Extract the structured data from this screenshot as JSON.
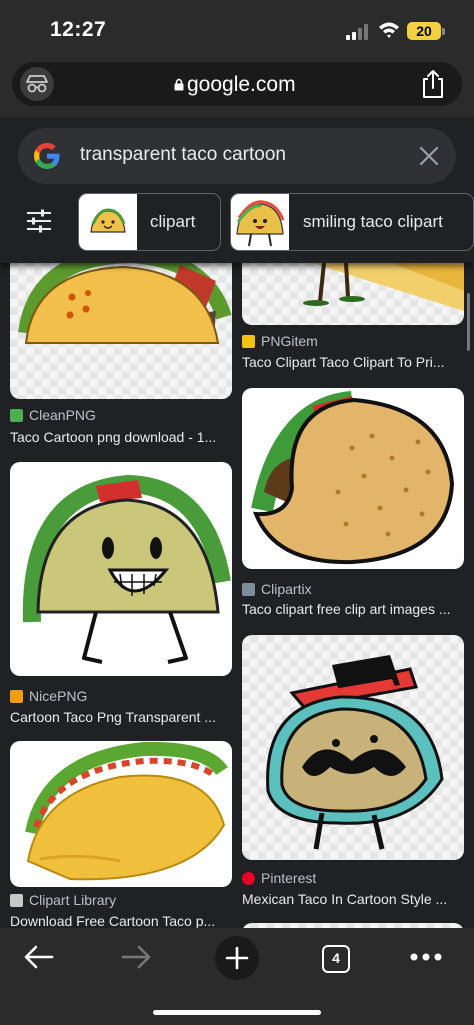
{
  "status_bar": {
    "time": "12:27",
    "battery": "20",
    "battery_color": "#f4d03f"
  },
  "browser": {
    "url": "google.com",
    "icons": [
      "incognito-icon",
      "lock-icon",
      "share-icon"
    ]
  },
  "search": {
    "query": "transparent taco cartoon",
    "icons": [
      "google-logo-icon",
      "clear-icon",
      "filter-icon"
    ]
  },
  "chips": [
    {
      "label": "clipart"
    },
    {
      "label": "smiling taco clipart"
    }
  ],
  "results": {
    "left": [
      {
        "source": "CleanPNG",
        "title": "Taco Cartoon png download - 1...",
        "favicon_color": "#4caf50"
      },
      {
        "source": "NicePNG",
        "title": "Cartoon Taco Png Transparent ...",
        "favicon_color": "#f39c12"
      },
      {
        "source": "Clipart Library",
        "title": "Download Free Cartoon Taco p...",
        "favicon_color": "#c7c7c7"
      }
    ],
    "right": [
      {
        "source": "PNGitem",
        "title": "Taco Clipart Taco Clipart To Pri...",
        "favicon_color": "#f1c40f"
      },
      {
        "source": "Clipartix",
        "title": "Taco clipart free clip art images ...",
        "favicon_color": "#7f8c9a"
      },
      {
        "source": "Pinterest",
        "title": "Mexican Taco In Cartoon Style ...",
        "favicon_color": "#e60023"
      }
    ]
  },
  "bottom_bar": {
    "tab_count": "4",
    "icons": [
      "back-arrow-icon",
      "forward-arrow-icon",
      "plus-icon",
      "more-icon"
    ]
  }
}
